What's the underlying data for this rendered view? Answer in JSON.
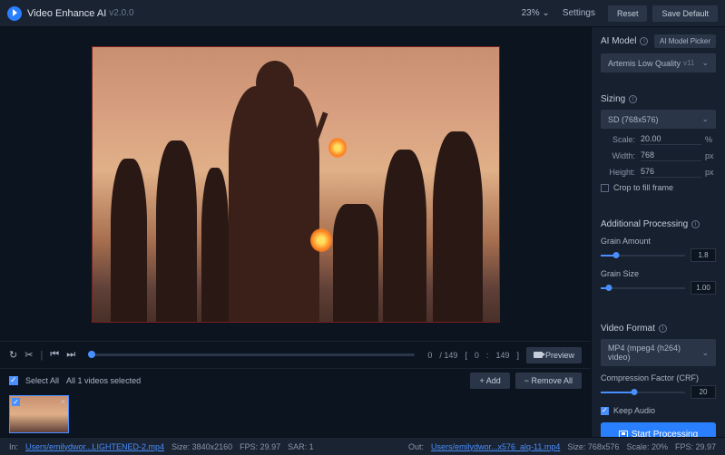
{
  "titlebar": {
    "app_name": "Video Enhance AI",
    "version": "v2.0.0",
    "zoom": "23%",
    "settings": "Settings",
    "reset": "Reset",
    "save_default": "Save Default"
  },
  "controls": {
    "cur_frame": "0",
    "total_frames": "/ 149",
    "range_open": "[",
    "range_start": "0",
    "range_mid": ":",
    "range_end": "149",
    "range_close": "]",
    "preview": "Preview"
  },
  "selbar": {
    "select_all": "Select All",
    "selected_info": "All 1 videos selected",
    "add": "+  Add",
    "remove": "−  Remove All"
  },
  "sidebar": {
    "ai_model": {
      "label": "AI Model",
      "picker": "AI Model Picker",
      "value": "Artemis Low Quality",
      "ver": "v11"
    },
    "sizing": {
      "label": "Sizing",
      "preset": "SD (768x576)",
      "scale_label": "Scale:",
      "scale": "20.00",
      "scale_unit": "%",
      "width_label": "Width:",
      "width": "768",
      "px": "px",
      "height_label": "Height:",
      "height": "576",
      "crop": "Crop to fill frame"
    },
    "processing": {
      "label": "Additional Processing",
      "grain_amount_label": "Grain Amount",
      "grain_amount": "1.8",
      "grain_size_label": "Grain Size",
      "grain_size": "1.00"
    },
    "format": {
      "label": "Video Format",
      "value": "MP4 (mpeg4 (h264) video)",
      "crf_label": "Compression Factor (CRF)",
      "crf": "20",
      "keep_audio": "Keep Audio"
    },
    "start": "Start Processing"
  },
  "status": {
    "in_label": "In:",
    "in_path": "Users/emilydwor...LIGHTENED-2.mp4",
    "in_size": "Size:  3840x2160",
    "in_fps": "FPS:  29.97",
    "in_sar": "SAR:  1",
    "out_label": "Out:",
    "out_path": "Users/emilydwor...x576_alq-11.mp4",
    "out_size": "Size:  768x576",
    "out_scale": "Scale:  20%",
    "out_fps": "FPS:  29.97"
  }
}
